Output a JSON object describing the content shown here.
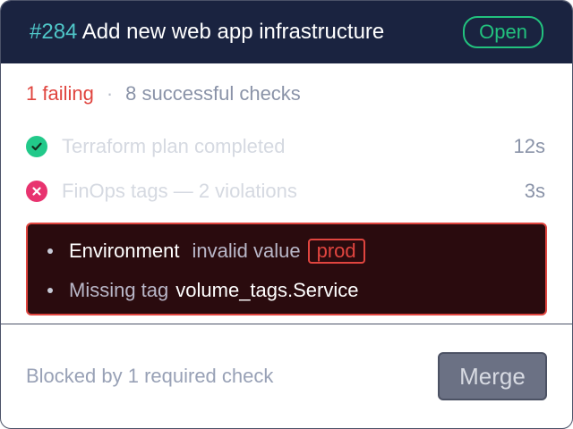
{
  "header": {
    "number": "#284",
    "title": "Add new web app infrastructure",
    "status": "Open"
  },
  "summary": {
    "failing": "1 failing",
    "separator": "·",
    "successful": "8 successful checks"
  },
  "checks": [
    {
      "icon": "check-circle-icon",
      "label": "Terraform plan completed",
      "time": "12s",
      "status": "success"
    },
    {
      "icon": "x-circle-icon",
      "label": "FinOps tags — 2 violations",
      "time": "3s",
      "status": "failure"
    }
  ],
  "violations": {
    "item1": {
      "name": "Environment",
      "message": "invalid value",
      "value": "prod"
    },
    "item2": {
      "prefix": "Missing tag",
      "tag": "volume_tags.Service"
    }
  },
  "footer": {
    "blocked_text": "Blocked by 1 required check",
    "merge_label": "Merge"
  },
  "colors": {
    "header_bg": "#1a2340",
    "accent_teal": "#4fc6c8",
    "open_green": "#22c27e",
    "failing_red": "#e0453f",
    "success_icon": "#22c98a",
    "failure_icon": "#e8336f",
    "violation_bg": "#2a0b0e"
  }
}
